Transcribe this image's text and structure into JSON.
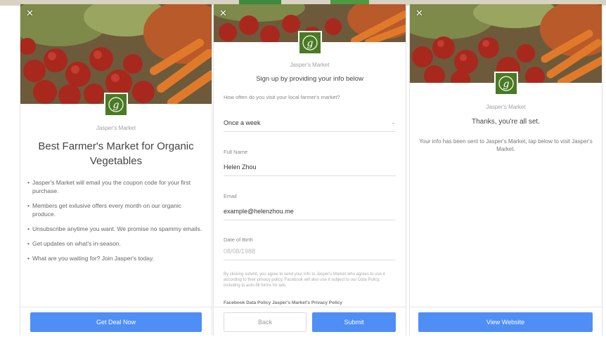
{
  "brand": "Jasper's Market",
  "logo_letter": "g",
  "colors": {
    "primary": "#4f8ef5",
    "logo_green": "#4a7a24"
  },
  "panel1": {
    "title": "Best Farmer's Market for Organic Vegetables",
    "bullets": [
      "Jasper's Market will email you the coupon code for your first purchase.",
      "Members get exlusive offers every month on our organic produce.",
      "Unsubscribe anytime you want. We promise no spammy emails.",
      "Get updates on what's in-season.",
      "What are you waiting for? Join Jasper's today."
    ],
    "cta": "Get Deal Now"
  },
  "panel2": {
    "subtitle": "Sign up by providing your info below",
    "question": "How often do you visit your local farmer's market?",
    "frequency_value": "Once a week",
    "fields": {
      "full_name": {
        "label": "Full Name",
        "value": "Helen Zhou"
      },
      "email": {
        "label": "Email",
        "value": "example@helenzhou.me"
      },
      "dob": {
        "label": "Date of Birth",
        "placeholder": "08/08/1988"
      }
    },
    "disclaimer": "By clicking submit, you agree to send your info to Jasper's Market who agrees to use it according to their privacy policy. Facebook will also use it subject to our Data Policy, including to auto-fill forms for ads.",
    "links": "Facebook Data Policy  Jasper's Market's Privacy Policy",
    "back_label": "Back",
    "submit_label": "Submit"
  },
  "panel3": {
    "title": "Thanks, you're all set.",
    "message": "Your info has been sent to Jasper's Market, tap below to visit Jasper's Market.",
    "cta": "View Website"
  },
  "icons": {
    "close": "close-icon",
    "logo": "jaspers-logo-icon",
    "dropdown": "chevron-down-icon"
  }
}
